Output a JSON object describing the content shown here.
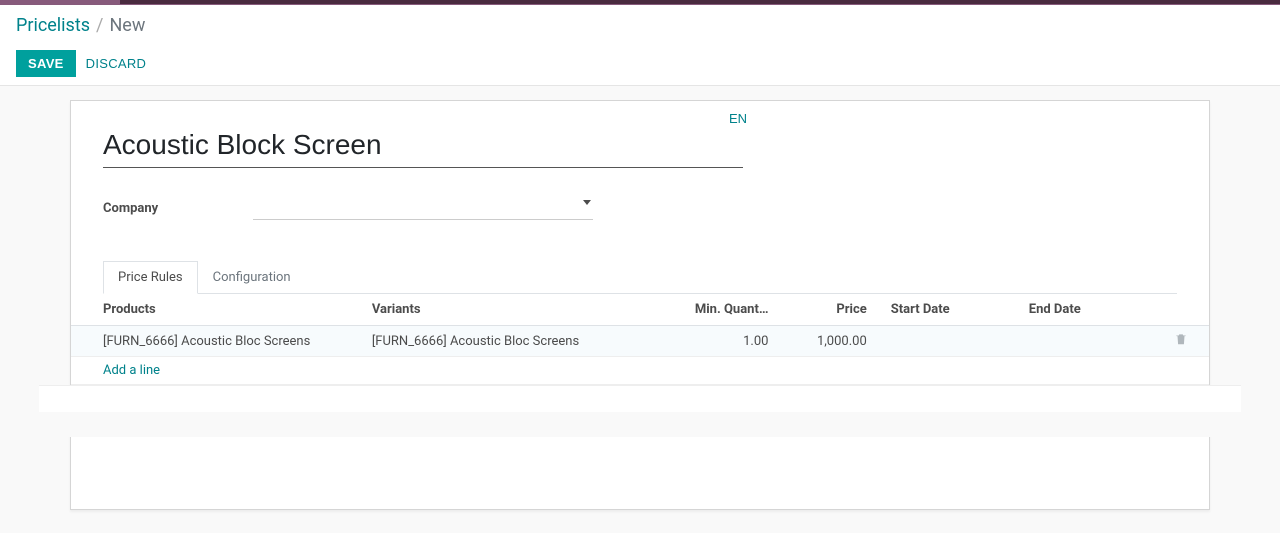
{
  "breadcrumb": {
    "root": "Pricelists",
    "sep": "/",
    "current": "New"
  },
  "buttons": {
    "save": "SAVE",
    "discard": "DISCARD",
    "lang": "EN"
  },
  "form": {
    "name_value": "Acoustic Block Screen",
    "company_label": "Company",
    "company_value": ""
  },
  "tabs": {
    "price_rules": "Price Rules",
    "configuration": "Configuration"
  },
  "table": {
    "headers": {
      "products": "Products",
      "variants": "Variants",
      "min_qty": "Min. Quant…",
      "price": "Price",
      "start_date": "Start Date",
      "end_date": "End Date"
    },
    "rows": [
      {
        "product": "[FURN_6666] Acoustic Bloc Screens",
        "variant": "[FURN_6666] Acoustic Bloc Screens",
        "min_qty": "1.00",
        "price": "1,000.00",
        "start_date": "",
        "end_date": ""
      }
    ],
    "add_line": "Add a line"
  }
}
